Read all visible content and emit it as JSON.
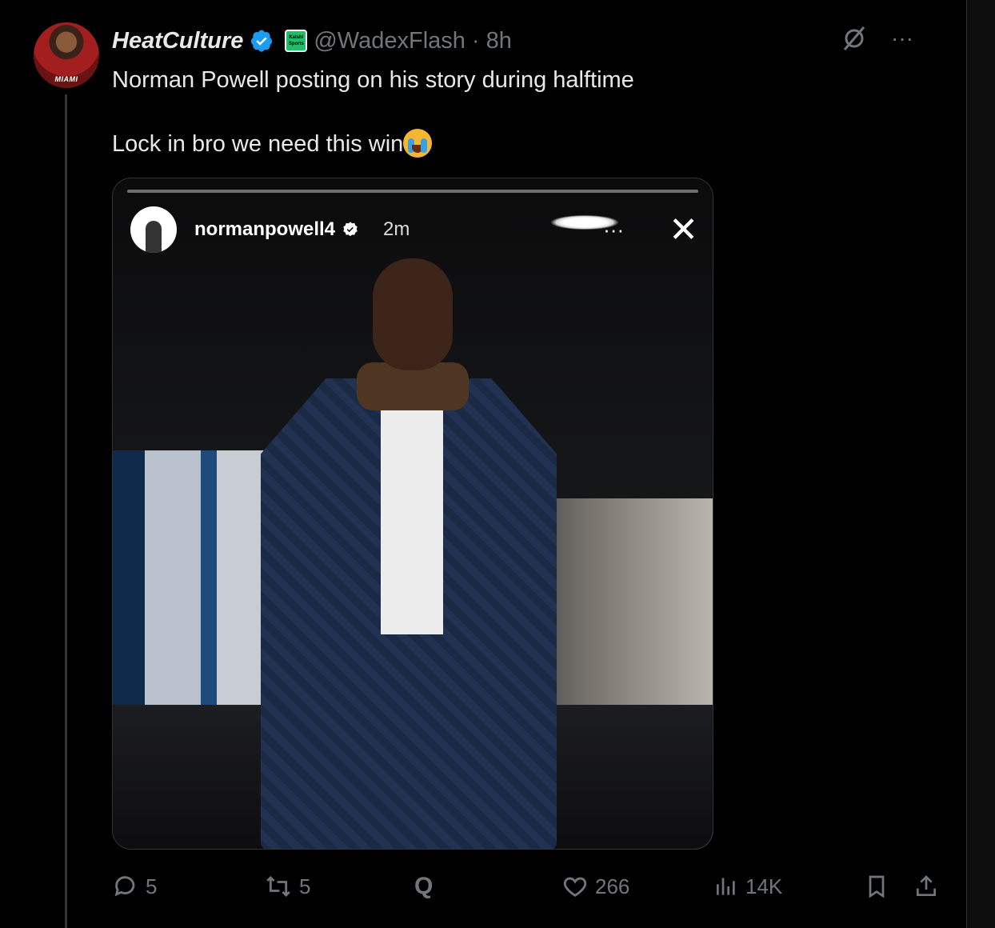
{
  "post": {
    "author_name": "HeatCulture",
    "handle": "@WadexFlash",
    "dot": "·",
    "time": "8h",
    "avatar_text": "MIAMI",
    "badge_text": "Kalshi Sports",
    "line1": "Norman Powell posting on his story during halftime",
    "line2": "Lock in bro we need this win",
    "icons": {
      "verified": "verified-badge-icon",
      "grok": "grok-icon",
      "more": "more-dots-icon"
    }
  },
  "story": {
    "username": "normanpowell4",
    "time": "2m",
    "more": "···",
    "close": "✕"
  },
  "actions": {
    "replies": "5",
    "reposts": "5",
    "grok_label": "Q",
    "likes": "266",
    "views": "14K"
  },
  "colors": {
    "background": "#000000",
    "text": "#e7e9ea",
    "muted": "#71767b",
    "verified_blue": "#1d9bf0"
  }
}
